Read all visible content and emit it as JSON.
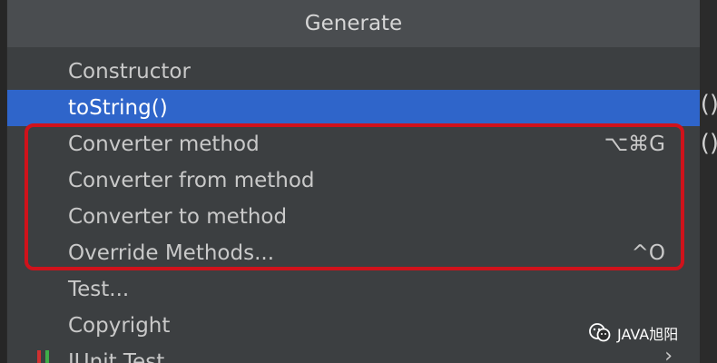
{
  "popup": {
    "title": "Generate",
    "items": [
      {
        "label": "Constructor",
        "shortcut": "",
        "selected": false
      },
      {
        "label": "toString()",
        "shortcut": "",
        "selected": true
      },
      {
        "label": "Converter method",
        "shortcut": "⌥⌘G",
        "selected": false
      },
      {
        "label": "Converter from method",
        "shortcut": "",
        "selected": false
      },
      {
        "label": "Converter to method",
        "shortcut": "",
        "selected": false
      },
      {
        "label": "Override Methods...",
        "shortcut": "^O",
        "selected": false
      },
      {
        "label": "Test...",
        "shortcut": "",
        "selected": false
      },
      {
        "label": "Copyright",
        "shortcut": "",
        "selected": false
      },
      {
        "label": "JUnit Test",
        "shortcut": "",
        "selected": false
      }
    ],
    "submenu_arrow": "›"
  },
  "background": {
    "paren_1": "()",
    "paren_2": "()"
  },
  "watermark": {
    "text": "JAVA旭阳",
    "icon": "wechat-icon"
  },
  "colors": {
    "selected": "#2f65ca",
    "highlight_box": "#d0121b",
    "popup_bg": "#3c3f41"
  }
}
